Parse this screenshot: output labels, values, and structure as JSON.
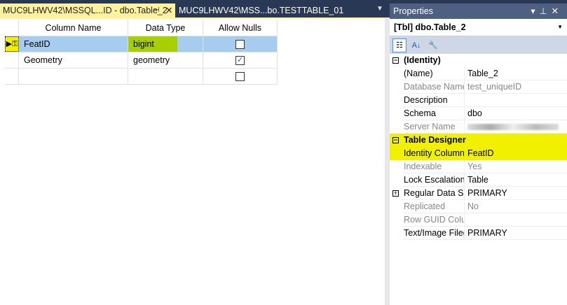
{
  "tabs": [
    {
      "label": "MUC9LHWV42\\MSSQL...ID - dbo.Table_2",
      "active": true
    },
    {
      "label": "MUC9LHWV42\\MSS...bo.TESTTABLE_01",
      "active": false
    }
  ],
  "grid": {
    "headers": [
      "Column Name",
      "Data Type",
      "Allow Nulls"
    ],
    "rows": [
      {
        "name": "FeatID",
        "type": "bigint",
        "nulls": false,
        "selected": true
      },
      {
        "name": "Geometry",
        "type": "geometry",
        "nulls": true
      },
      {
        "name": "",
        "type": "",
        "nulls": false
      }
    ]
  },
  "properties": {
    "title": "Properties",
    "object": "[Tbl] dbo.Table_2",
    "identity": {
      "label": "(Identity)",
      "items": [
        {
          "name": "(Name)",
          "value": "Table_2"
        },
        {
          "name": "Database Name",
          "value": "test_uniqueID"
        },
        {
          "name": "Description",
          "value": ""
        },
        {
          "name": "Schema",
          "value": "dbo"
        },
        {
          "name": "Server Name",
          "value": ""
        }
      ]
    },
    "designer": {
      "label": "Table Designer",
      "items": [
        {
          "name": "Identity Column",
          "value": "FeatID"
        },
        {
          "name": "Indexable",
          "value": "Yes"
        },
        {
          "name": "Lock Escalation",
          "value": "Table"
        },
        {
          "name": "Regular Data Spa",
          "value": "PRIMARY"
        },
        {
          "name": "Replicated",
          "value": "No"
        },
        {
          "name": "Row GUID Colur",
          "value": ""
        },
        {
          "name": "Text/Image Fileg",
          "value": "PRIMARY"
        }
      ]
    }
  },
  "colors": {
    "active_tab": "#fff29d",
    "highlight": "#f0f000",
    "selection": "#a6cdf0",
    "datatype_sel": "#a8cf00"
  }
}
